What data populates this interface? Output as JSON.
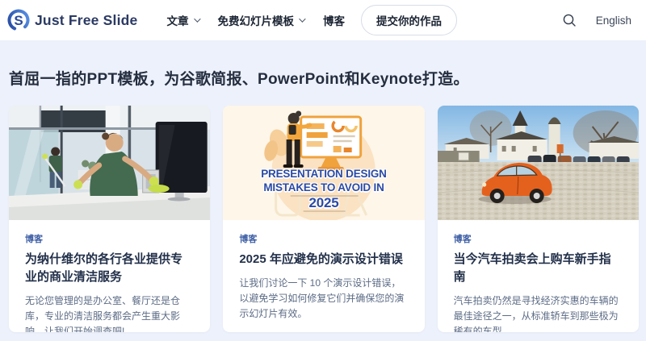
{
  "header": {
    "logo_text": "Just Free Slide",
    "nav": [
      {
        "label": "文章",
        "has_dropdown": true
      },
      {
        "label": "免费幻灯片模板",
        "has_dropdown": true
      },
      {
        "label": "博客",
        "has_dropdown": false
      }
    ],
    "submit_button": "提交你的作品",
    "language": "English"
  },
  "hero": {
    "heading": "首屈一指的PPT模板，为谷歌简报、PowerPoint和Keynote打造。"
  },
  "cards": [
    {
      "tag": "博客",
      "title": "为纳什维尔的各行各业提供专业的商业清洁服务",
      "description": "无论您管理的是办公室、餐厅还是仓库，专业的清洁服务都会产生重大影响。让我们开始调查吧!",
      "image": "office-cleaning-photo"
    },
    {
      "tag": "博客",
      "title": "2025 年应避免的演示设计错误",
      "description": "让我们讨论一下 10 个演示设计错误，以避免学习如何修复它们并确保您的演示幻灯片有效。",
      "image": "presentation-design-illustration",
      "image_text_lines": [
        "PRESENTATION DESIGN",
        "MISTAKES TO AVOID IN",
        "2025"
      ]
    },
    {
      "tag": "博客",
      "title": "当今汽车拍卖会上购车新手指南",
      "description": "汽车拍卖仍然是寻找经济实惠的车辆的最佳途径之一，从标准轿车到那些极为稀有的车型。",
      "image": "orange-car-auction-photo"
    }
  ],
  "colors": {
    "header_bg": "#ffffff",
    "hero_bg": "#edf1fb",
    "tag_blue": "#3e5fa5",
    "title_navy": "#22304a",
    "desc_gray": "#5d6c86",
    "logo_blue": "#2f6bd8"
  }
}
